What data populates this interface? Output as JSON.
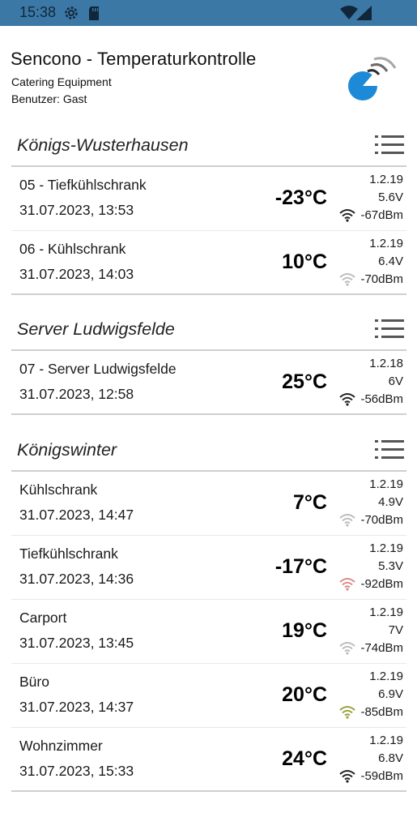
{
  "status_bar": {
    "time": "15:38",
    "icons": [
      "settings-icon",
      "sd-card-icon",
      "wifi-icon",
      "cellular-signal-icon"
    ]
  },
  "header": {
    "title": "Sencono - Temperaturkontrolle",
    "company": "Catering Equipment",
    "user": "Benutzer: Gast",
    "logo_icon": "sencono-logo-icon"
  },
  "colors": {
    "status_bar": "#3c78a5",
    "logo_blue": "#1d8ad8",
    "divider": "#cfcfcf",
    "wifi_ok": "#222222",
    "wifi_weak": "#bdbdbd",
    "wifi_bad": "#d98c8c",
    "wifi_fair": "#9aa040"
  },
  "sections": [
    {
      "title": "Königs-Wusterhausen",
      "menu_icon": "list-icon",
      "sensors": [
        {
          "name": "05 - Tiefkühlschrank",
          "date": "31.07.2023, 13:53",
          "temp": "-23°C",
          "fw": "1.2.19",
          "volt": "5.6V",
          "rssi": "-67dBm",
          "signal": "ok"
        },
        {
          "name": "06 - Kühlschrank",
          "date": "31.07.2023, 14:03",
          "temp": "10°C",
          "fw": "1.2.19",
          "volt": "6.4V",
          "rssi": "-70dBm",
          "signal": "weak"
        }
      ]
    },
    {
      "title": "Server Ludwigsfelde",
      "menu_icon": "list-icon",
      "sensors": [
        {
          "name": "07 - Server Ludwigsfelde",
          "date": "31.07.2023, 12:58",
          "temp": "25°C",
          "fw": "1.2.18",
          "volt": "6V",
          "rssi": "-56dBm",
          "signal": "ok"
        }
      ]
    },
    {
      "title": "Königswinter",
      "menu_icon": "list-icon",
      "sensors": [
        {
          "name": "Kühlschrank",
          "date": "31.07.2023, 14:47",
          "temp": "7°C",
          "fw": "1.2.19",
          "volt": "4.9V",
          "rssi": "-70dBm",
          "signal": "weak"
        },
        {
          "name": "Tiefkühlschrank",
          "date": "31.07.2023, 14:36",
          "temp": "-17°C",
          "fw": "1.2.19",
          "volt": "5.3V",
          "rssi": "-92dBm",
          "signal": "bad"
        },
        {
          "name": "Carport",
          "date": "31.07.2023, 13:45",
          "temp": "19°C",
          "fw": "1.2.19",
          "volt": "7V",
          "rssi": "-74dBm",
          "signal": "weak"
        },
        {
          "name": "Büro",
          "date": "31.07.2023, 14:37",
          "temp": "20°C",
          "fw": "1.2.19",
          "volt": "6.9V",
          "rssi": "-85dBm",
          "signal": "fair"
        },
        {
          "name": "Wohnzimmer",
          "date": "31.07.2023, 15:33",
          "temp": "24°C",
          "fw": "1.2.19",
          "volt": "6.8V",
          "rssi": "-59dBm",
          "signal": "ok"
        }
      ]
    }
  ]
}
